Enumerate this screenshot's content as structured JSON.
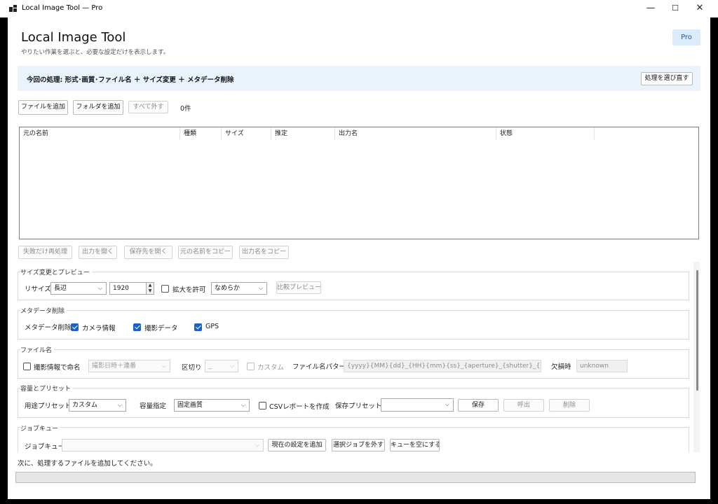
{
  "window": {
    "title": "Local Image Tool — Pro",
    "minimize": "—",
    "maximize": "☐",
    "close": "✕"
  },
  "header": {
    "title": "Local Image Tool",
    "subtitle": "やりたい作業を選ぶと、必要な設定だけを表示します。",
    "badge": "Pro"
  },
  "banner": {
    "text": "今回の処理: 形式･画質･ファイル名 ＋ サイズ変更 ＋ メタデータ削除",
    "reselect_button": "処理を選び直す"
  },
  "toolbar": {
    "add_files": "ファイルを追加",
    "add_folder": "フォルダを追加",
    "remove_all": "すべて外す",
    "count": "0件"
  },
  "table": {
    "columns": [
      "元の名前",
      "種類",
      "サイズ",
      "推定",
      "出力名",
      "状態"
    ],
    "rows": []
  },
  "actions": {
    "retry_failed": "失敗だけ再処理",
    "open_output": "出力を開く",
    "open_destination": "保存先を開く",
    "copy_original_name": "元の名前をコピー",
    "copy_output_name": "出力名をコピー"
  },
  "resize_section": {
    "legend": "サイズ変更とプレビュー",
    "resize_label": "リサイズ",
    "resize_mode": "長辺",
    "size_value": "1920",
    "allow_enlarge_label": "拡大を許可",
    "allow_enlarge_checked": false,
    "quality_mode": "なめらか",
    "compare_preview": "比較プレビュー"
  },
  "metadata_section": {
    "legend": "メタデータ削除",
    "label": "メタデータ削除",
    "camera_info": "カメラ情報",
    "camera_info_checked": true,
    "shooting_data": "撮影データ",
    "shooting_data_checked": true,
    "gps": "GPS",
    "gps_checked": true
  },
  "filename_section": {
    "legend": "ファイル名",
    "name_by_exif": "撮影情報で命名",
    "name_by_exif_checked": false,
    "naming_mode": "撮影日時＋連番",
    "separator_label": "区切り",
    "separator_value": "_",
    "custom_label": "カスタム",
    "custom_checked": false,
    "pattern_label": "ファイル名パターン",
    "pattern_value": "{yyyy}{MM}{dd}_{HH}{mm}{ss}_{aperture}_{shutter}_{iso}_{flash}_{",
    "missing_label": "欠損時",
    "missing_value": "unknown"
  },
  "preset_section": {
    "legend": "容量とプリセット",
    "usage_label": "用途プリセット",
    "usage_value": "カスタム",
    "capacity_label": "容量指定",
    "capacity_value": "固定画質",
    "csv_report": "CSVレポートを作成",
    "csv_checked": false,
    "save_preset_label": "保存プリセット",
    "save_preset_value": "",
    "save_button": "保存",
    "load_button": "呼出",
    "delete_button": "削除"
  },
  "queue_section": {
    "legend": "ジョブキュー",
    "label": "ジョブキュー",
    "queue_value": "",
    "add_current": "現在の設定を追加",
    "remove_selected": "選択ジョブを外す",
    "clear_queue": "キューを空にする"
  },
  "status": {
    "message": "次に、処理するファイルを追加してください。",
    "progress": 0
  }
}
